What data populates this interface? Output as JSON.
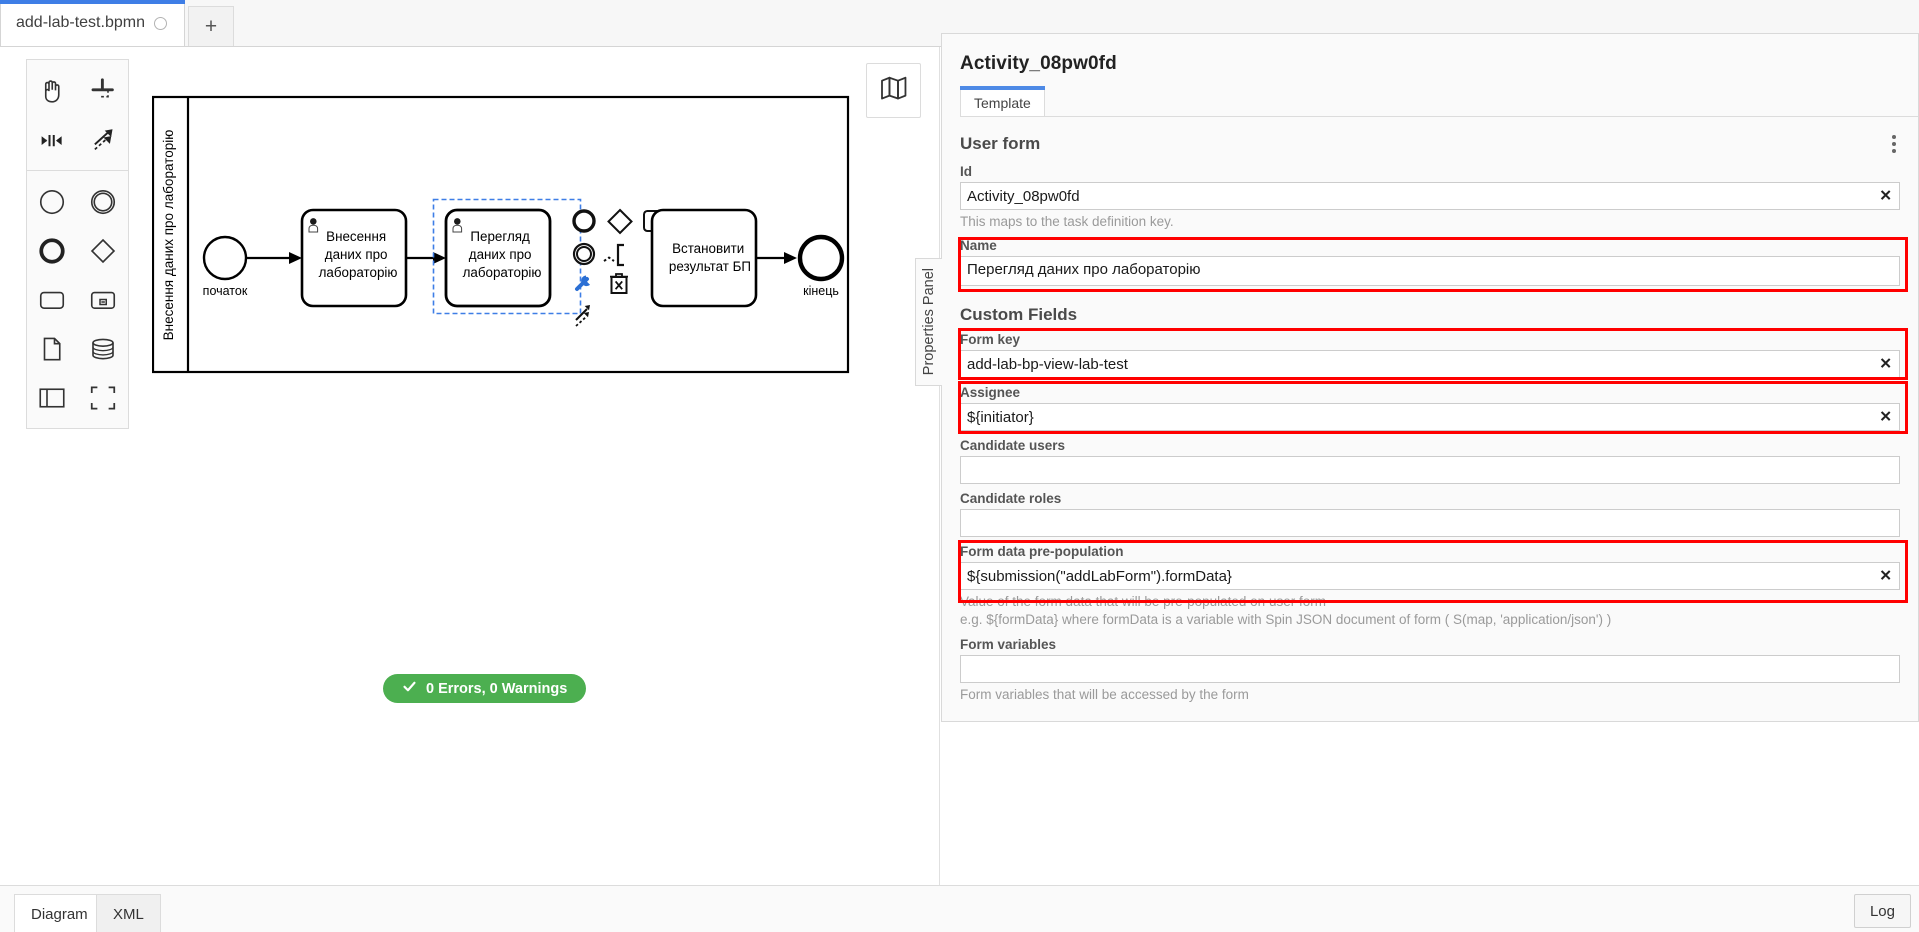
{
  "window": {
    "tabs": [
      {
        "label": "add-lab-test.bpmn",
        "dirty_icon": "circle-icon",
        "active": true
      }
    ],
    "add_tab_label": "+"
  },
  "palette": {
    "groups": [
      {
        "tools": [
          {
            "name": "hand-tool-icon",
            "title": "Activate the hand tool"
          },
          {
            "name": "lasso-tool-icon",
            "title": "Activate the lasso tool"
          },
          {
            "name": "space-tool-icon",
            "title": "Activate the create/remove space tool"
          },
          {
            "name": "global-connect-tool-icon",
            "title": "Activate the global connect tool"
          }
        ]
      },
      {
        "tools": [
          {
            "name": "start-event-icon",
            "title": "Create StartEvent"
          },
          {
            "name": "intermediate-event-icon",
            "title": "Create Intermediate/Boundary Event"
          },
          {
            "name": "end-event-icon",
            "title": "Create EndEvent"
          },
          {
            "name": "gateway-icon",
            "title": "Create Gateway"
          },
          {
            "name": "task-icon",
            "title": "Create Task"
          },
          {
            "name": "subprocess-icon",
            "title": "Create expanded SubProcess"
          },
          {
            "name": "data-object-icon",
            "title": "Create DataObjectReference"
          },
          {
            "name": "data-store-icon",
            "title": "Create DataStoreReference"
          },
          {
            "name": "participant-icon",
            "title": "Create Pool/Participant"
          },
          {
            "name": "group-icon",
            "title": "Create Group"
          }
        ]
      }
    ]
  },
  "canvas": {
    "minimap_icon": "map-icon",
    "pool_label": "Внесення даних про лабораторію",
    "nodes": [
      {
        "type": "start-event",
        "label": "початок"
      },
      {
        "type": "user-task",
        "label": "Внесення даних про лабораторію"
      },
      {
        "type": "user-task",
        "label": "Перегляд даних про лабораторію",
        "selected": true
      },
      {
        "type": "service-task",
        "label": "Встановити результат БП"
      },
      {
        "type": "end-event",
        "label": "кінець"
      }
    ],
    "context_pad": [
      {
        "name": "append-end-event-icon"
      },
      {
        "name": "append-gateway-icon"
      },
      {
        "name": "append-task-icon"
      },
      {
        "name": "append-intermediate-event-icon"
      },
      {
        "name": "append-text-annotation-icon"
      },
      {
        "name": "change-type-wrench-icon"
      },
      {
        "name": "delete-trash-icon"
      },
      {
        "name": "connect-arrow-icon"
      }
    ],
    "status": {
      "icon": "check-icon",
      "text": "0 Errors, 0 Warnings"
    }
  },
  "bottom": {
    "tabs": [
      {
        "label": "Diagram",
        "active": true
      },
      {
        "label": "XML",
        "active": false
      }
    ],
    "log_label": "Log"
  },
  "properties": {
    "vertical_tab_label": "Properties Panel",
    "element_title": "Activity_08pw0fd",
    "tabs": [
      {
        "label": "Template",
        "active": true
      }
    ],
    "group_title": "User form",
    "kebab_icon": "more-vertical-icon",
    "fields": [
      {
        "label": "Id",
        "value": "Activity_08pw0fd",
        "placeholder": "",
        "help": "This maps to the task definition key.",
        "clearable": true,
        "highlighted": false,
        "multiline": false
      },
      {
        "label": "Name",
        "value": "Перегляд даних про лабораторію",
        "placeholder": "",
        "help": "",
        "clearable": false,
        "highlighted": true,
        "multiline": true
      }
    ],
    "custom_fields_title": "Custom Fields",
    "custom_fields": [
      {
        "label": "Form key",
        "value": "add-lab-bp-view-lab-test",
        "placeholder": "",
        "help": "",
        "clearable": true,
        "highlighted": true
      },
      {
        "label": "Assignee",
        "value": "${initiator}",
        "placeholder": "",
        "help": "",
        "clearable": true,
        "highlighted": true
      },
      {
        "label": "Candidate users",
        "value": "",
        "placeholder": "",
        "help": "",
        "clearable": false,
        "highlighted": false
      },
      {
        "label": "Candidate roles",
        "value": "",
        "placeholder": "",
        "help": "",
        "clearable": false,
        "highlighted": false
      },
      {
        "label": "Form data pre-population",
        "value": "${submission(\"addLabForm\").formData}",
        "placeholder": "",
        "help": "Value of the form data that will be pre-populated on user form",
        "help2": "e.g. ${formData} where formData is a variable with Spin JSON document of form ( S(map, 'application/json') )",
        "clearable": true,
        "highlighted": true
      },
      {
        "label": "Form variables",
        "value": "",
        "placeholder": "",
        "help": "Form variables that will be accessed by the form",
        "clearable": false,
        "highlighted": false
      }
    ]
  },
  "colors": {
    "accent": "#3e7ee6",
    "highlight": "#ff0000",
    "success": "#4caf50",
    "panel_bg": "#fafafa"
  }
}
